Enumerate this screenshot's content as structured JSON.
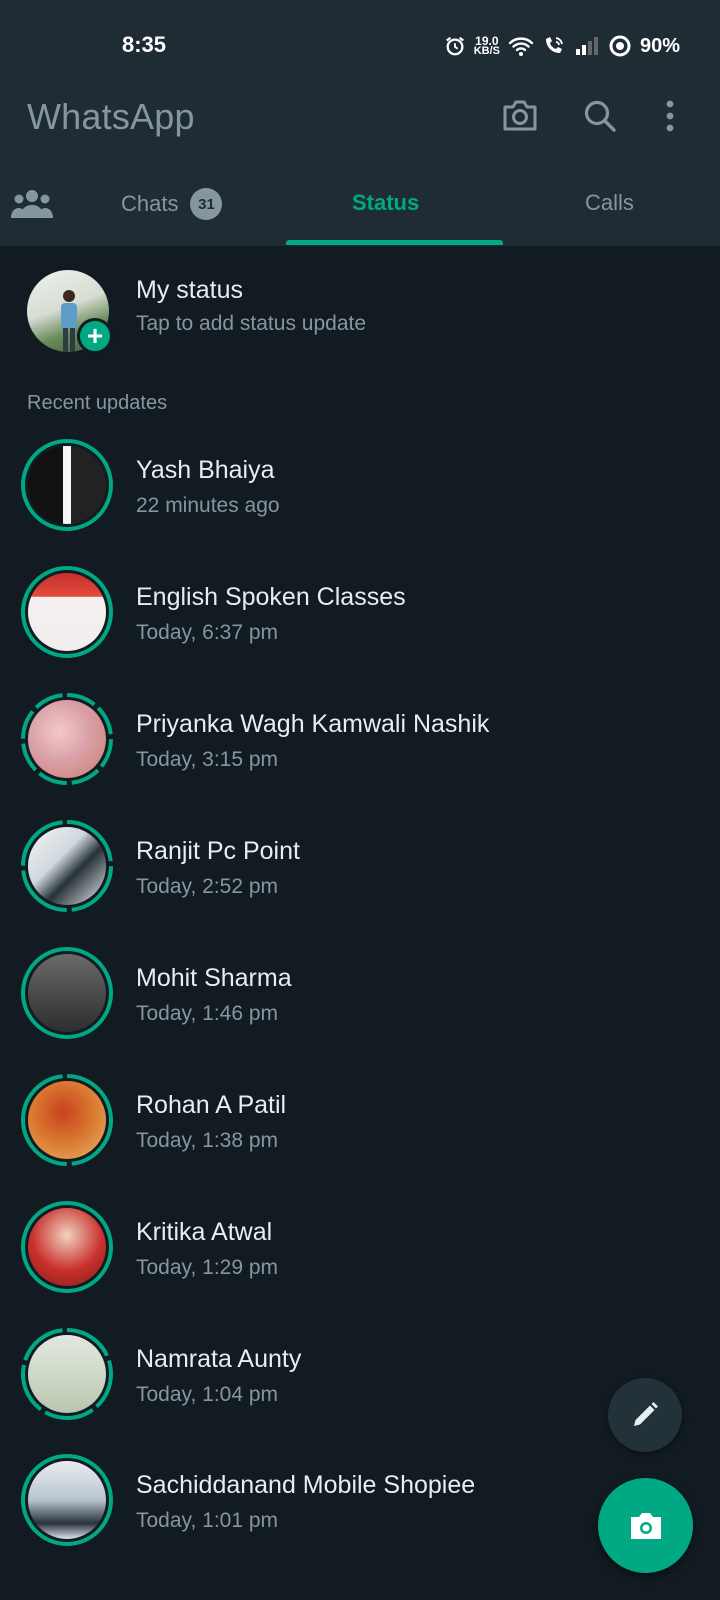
{
  "status_bar": {
    "time": "8:35",
    "net_speed_value": "19.0",
    "net_speed_unit": "KB/S",
    "battery": "90%",
    "icons": [
      "alarm-icon",
      "wifi-icon",
      "wifi-calling-icon",
      "signal-icon",
      "battery-ring-icon"
    ]
  },
  "appbar": {
    "title": "WhatsApp",
    "icons": [
      "camera-icon",
      "search-icon",
      "more-vert-icon"
    ]
  },
  "tabs": {
    "community_icon": "community-icon",
    "chats_label": "Chats",
    "chats_badge": "31",
    "status_label": "Status",
    "calls_label": "Calls",
    "active": "Status"
  },
  "my_status": {
    "name": "My status",
    "subtitle": "Tap to add status update",
    "add_icon": "+"
  },
  "recent_label": "Recent updates",
  "updates": [
    {
      "name": "Yash Bhaiya",
      "time": "22 minutes ago"
    },
    {
      "name": "English Spoken Classes",
      "time": "Today, 6:37 pm"
    },
    {
      "name": "Priyanka Wagh Kamwali Nashik",
      "time": "Today, 3:15 pm"
    },
    {
      "name": "Ranjit Pc Point",
      "time": "Today, 2:52 pm"
    },
    {
      "name": "Mohit Sharma",
      "time": "Today, 1:46 pm"
    },
    {
      "name": "Rohan A Patil",
      "time": "Today, 1:38 pm"
    },
    {
      "name": "Kritika Atwal",
      "time": "Today, 1:29 pm"
    },
    {
      "name": "Namrata Aunty",
      "time": "Today, 1:04 pm"
    },
    {
      "name": "Sachiddanand Mobile Shopiee",
      "time": "Today, 1:01 pm"
    }
  ],
  "fabs": {
    "pencil_icon": "pencil-icon",
    "camera_icon": "camera-icon"
  },
  "colors": {
    "background": "#111b21",
    "header": "#1f2c34",
    "accent": "#00a884",
    "secondary_text": "#8696a0"
  }
}
